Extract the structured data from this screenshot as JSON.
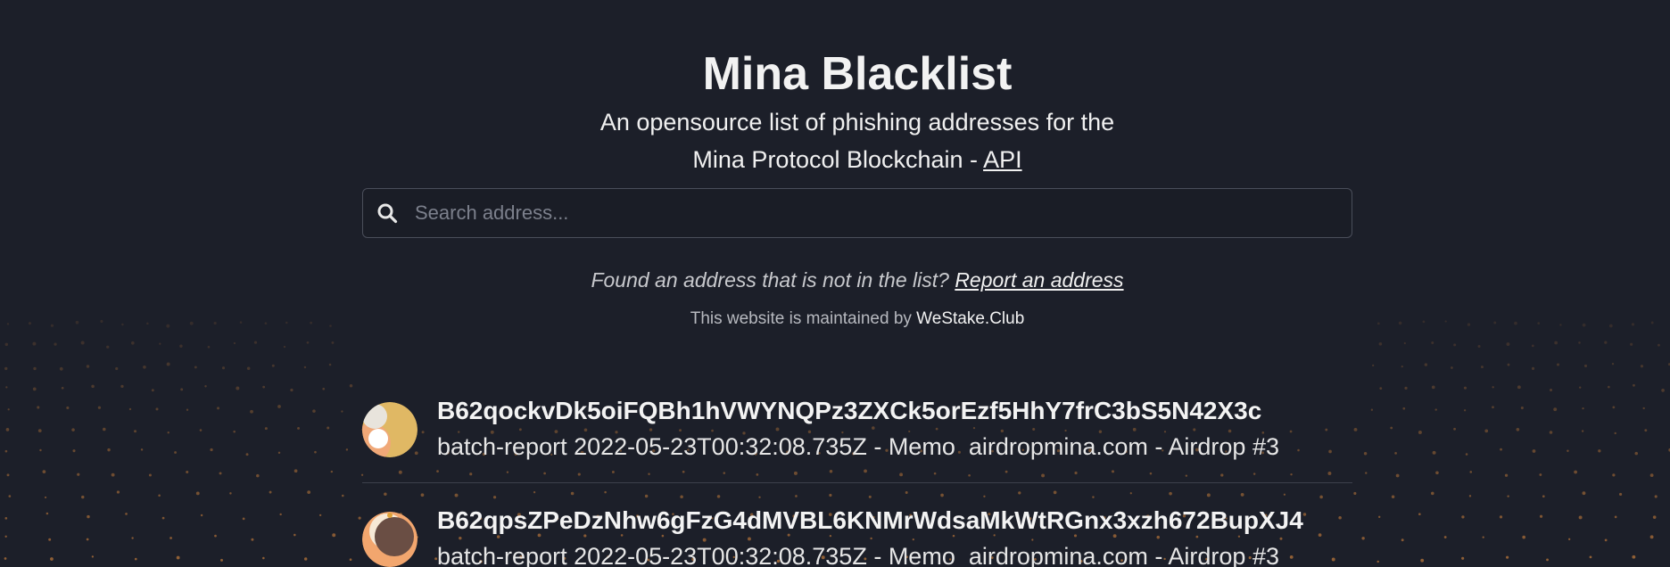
{
  "header": {
    "title": "Mina Blacklist",
    "subtitle_line1": "An opensource list of phishing addresses for the",
    "subtitle_line2_prefix": "Mina Protocol Blockchain - ",
    "api_link": "API"
  },
  "search": {
    "placeholder": "Search address...",
    "value": "",
    "icon": "search-icon"
  },
  "report": {
    "prompt": "Found an address that is not in the list? ",
    "link": "Report an address"
  },
  "footer": {
    "maintained_prefix": "This website is maintained by ",
    "maintainer_link": "WeStake.Club"
  },
  "list": {
    "items": [
      {
        "address": "B62qockvDk5oiFQBh1hVWYNQPz3ZXCk5orEzf5HhY7frC3bS5N42X3c",
        "memo": "batch-report 2022-05-23T00:32:08.735Z - Memo  airdropmina.com - Airdrop #3",
        "avatar_colors": [
          "#e0b864",
          "#f0a878",
          "#e8e4dc",
          "#ffffff"
        ]
      },
      {
        "address": "B62qpsZPeDzNhw6gFzG4dMVBL6KNMrWdsaMkWtRGnx3xzh672BupXJ4",
        "memo": "batch-report 2022-05-23T00:32:08.735Z - Memo  airdropmina.com - Airdrop #3",
        "avatar_colors": [
          "#f2a66e",
          "#6a4e44",
          "#f7e9d6",
          "#e0a23a"
        ]
      }
    ]
  },
  "colors": {
    "background": "#1c1f29",
    "text": "#f2f2f2",
    "muted": "#b7b9bf",
    "border": "#4a4e5a",
    "dots": "#c07a3a"
  }
}
